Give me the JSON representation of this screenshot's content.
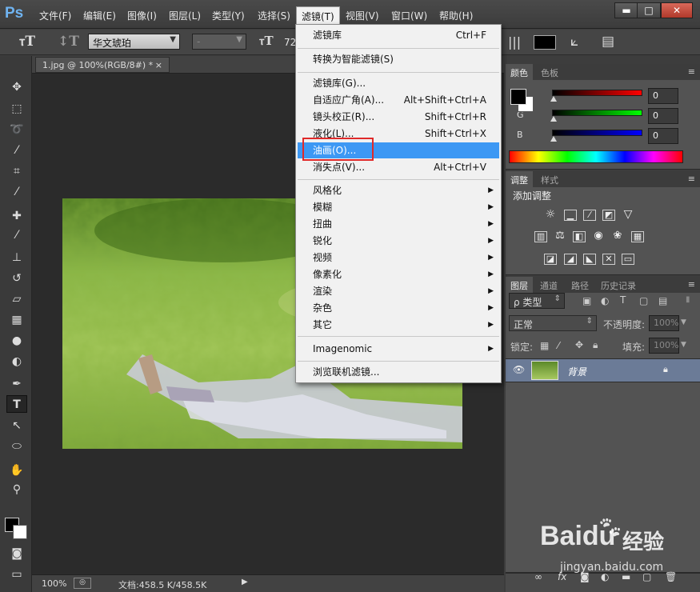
{
  "app": {
    "logo": "Ps"
  },
  "menubar": [
    "文件(F)",
    "编辑(E)",
    "图像(I)",
    "图层(L)",
    "类型(Y)",
    "选择(S)",
    "滤镜(T)",
    "视图(V)",
    "窗口(W)",
    "帮助(H)"
  ],
  "window_controls": {
    "minimize": "▬",
    "maximize": "□",
    "close": "✕"
  },
  "options_bar": {
    "font_family": "华文琥珀",
    "font_style": "-",
    "font_size": "72"
  },
  "document": {
    "tab_title": "1.jpg @ 100%(RGB/8#) *",
    "tab_close": "×"
  },
  "status": {
    "zoom": "100%",
    "doc_info": "文档:458.5 K/458.5K"
  },
  "filter_menu": {
    "items": [
      {
        "label": "滤镜库",
        "shortcut": "Ctrl+F"
      },
      {
        "label": "转换为智能滤镜(S)",
        "shortcut": ""
      },
      {
        "label": "滤镜库(G)...",
        "shortcut": ""
      },
      {
        "label": "自适应广角(A)...",
        "shortcut": "Alt+Shift+Ctrl+A"
      },
      {
        "label": "镜头校正(R)...",
        "shortcut": "Shift+Ctrl+R"
      },
      {
        "label": "液化(L)...",
        "shortcut": "Shift+Ctrl+X"
      },
      {
        "label": "油画(O)...",
        "shortcut": "",
        "highlighted": true
      },
      {
        "label": "消失点(V)...",
        "shortcut": "Alt+Ctrl+V"
      },
      {
        "label": "风格化",
        "submenu": true
      },
      {
        "label": "模糊",
        "submenu": true
      },
      {
        "label": "扭曲",
        "submenu": true
      },
      {
        "label": "锐化",
        "submenu": true
      },
      {
        "label": "视频",
        "submenu": true
      },
      {
        "label": "像素化",
        "submenu": true
      },
      {
        "label": "渲染",
        "submenu": true
      },
      {
        "label": "杂色",
        "submenu": true
      },
      {
        "label": "其它",
        "submenu": true
      },
      {
        "label": "Imagenomic",
        "submenu": true
      },
      {
        "label": "浏览联机滤镜...",
        "shortcut": ""
      }
    ]
  },
  "color_panel": {
    "tabs": [
      "颜色",
      "色板"
    ],
    "channels": [
      {
        "label": "R",
        "value": "0"
      },
      {
        "label": "G",
        "value": "0"
      },
      {
        "label": "B",
        "value": "0"
      }
    ]
  },
  "adjust_panel": {
    "tabs": [
      "调整",
      "样式"
    ],
    "title": "添加调整"
  },
  "layers_panel": {
    "tabs": [
      "图层",
      "通道",
      "路径",
      "历史记录"
    ],
    "filter_kind": "ρ 类型",
    "blend_mode": "正常",
    "opacity_label": "不透明度:",
    "opacity_value": "100%",
    "lock_label": "锁定:",
    "fill_label": "填充:",
    "fill_value": "100%",
    "layer_name": "背景"
  },
  "footer_icons": [
    "∞",
    "fx"
  ],
  "watermark": {
    "brand": "Baidu",
    "chinese": "经验",
    "url": "jingyan.baidu.com"
  },
  "colors": {
    "menu_highlight": "#3d98f4",
    "annotation_box": "#e02a2a",
    "panel_bg": "#535353"
  }
}
